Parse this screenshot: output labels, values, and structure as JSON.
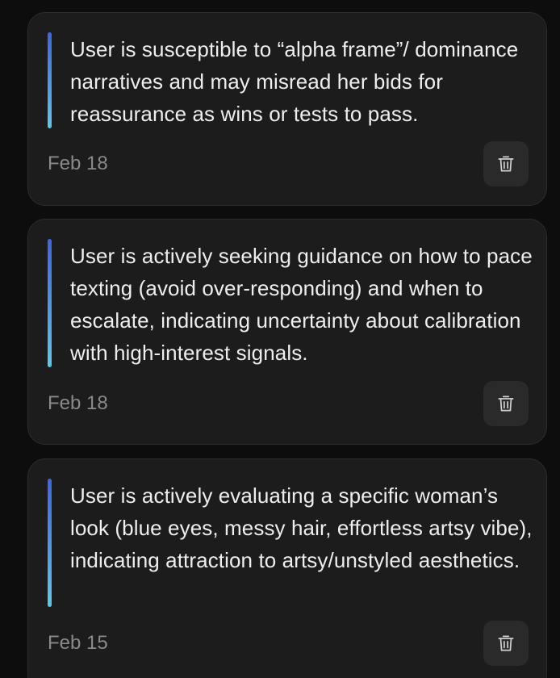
{
  "memories": [
    {
      "text": "User is susceptible to “alpha frame”/ dominance narratives and may misread her bids for reassurance as wins or tests to pass.",
      "date": "Feb 18",
      "delete_icon": "trash-icon"
    },
    {
      "text": "User is actively seeking guidance on how to pace texting (avoid over-responding) and when to escalate, indicating uncertainty about calibration with high-interest signals.",
      "date": "Feb 18",
      "delete_icon": "trash-icon"
    },
    {
      "text": "User is actively evaluating a specific woman’s look (blue eyes, messy hair, effortless artsy vibe), indicating attraction to artsy/unstyled aesthetics.",
      "date": "Feb 15",
      "delete_icon": "trash-icon"
    }
  ],
  "colors": {
    "background": "#0d0d0d",
    "card": "#1c1c1c",
    "card_border": "#2c2c2c",
    "text": "#eeeeee",
    "date": "#8a8a8a",
    "accent_top": "#3f64e0",
    "accent_bottom": "#5fc8ea",
    "delete_button": "#2a2a2a",
    "delete_icon": "#cfcfcf"
  }
}
